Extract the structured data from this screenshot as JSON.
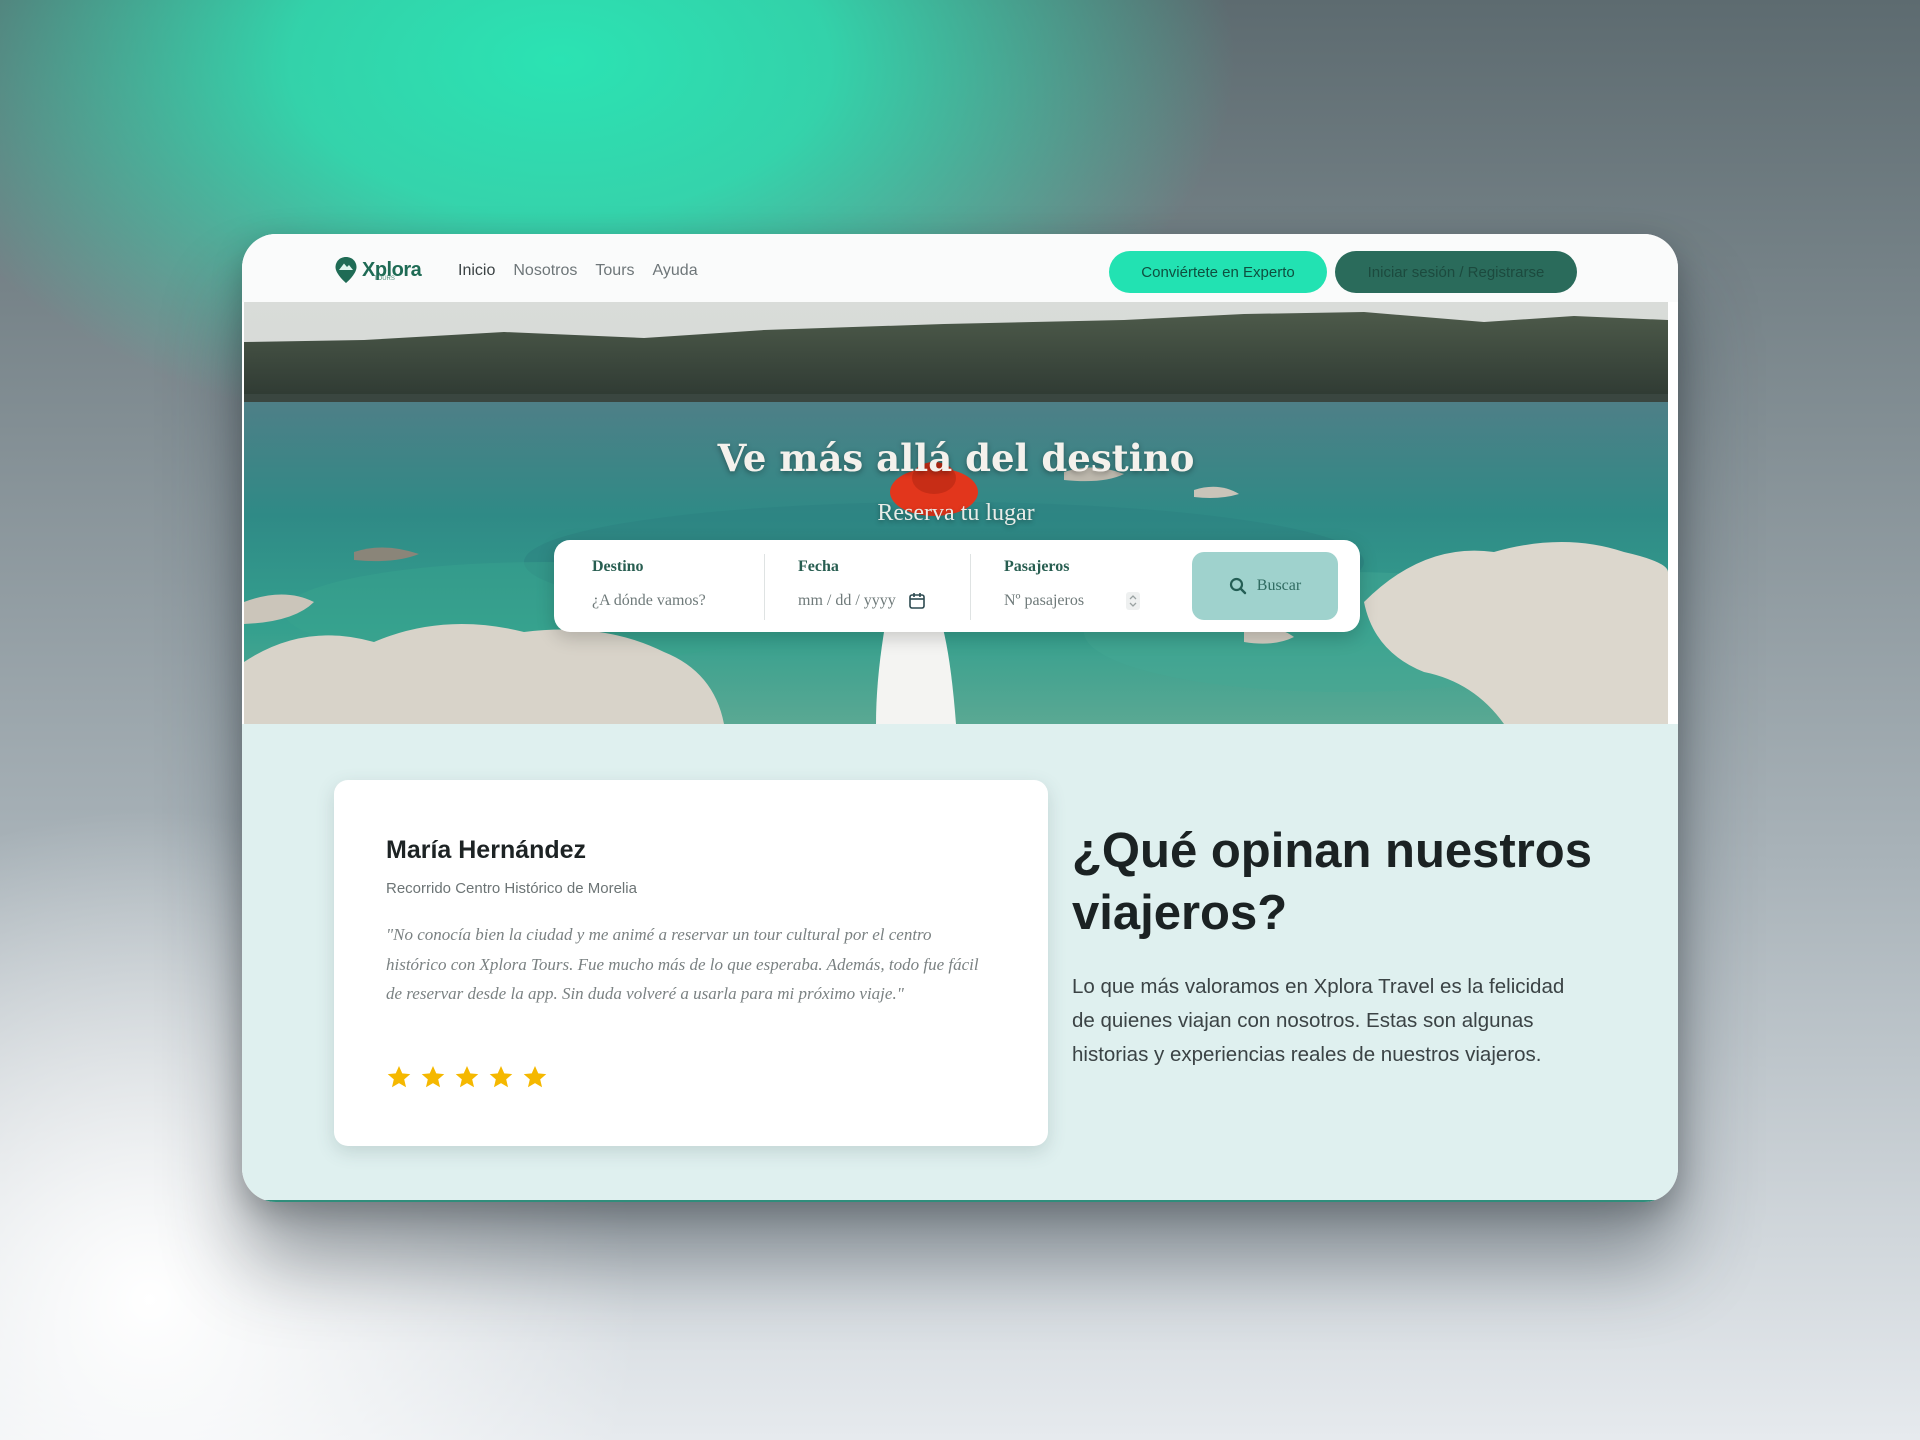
{
  "nav": {
    "logo_text": "Xplora",
    "logo_sub": "TOURS",
    "links": [
      "Inicio",
      "Nosotros",
      "Tours",
      "Ayuda"
    ],
    "expert_button": "Conviértete en Experto",
    "login_button": "Iniciar sesión / Registrarse"
  },
  "hero": {
    "title": "Ve más allá del destino",
    "subtitle": "Reserva tu lugar"
  },
  "search": {
    "destino_label": "Destino",
    "destino_placeholder": "¿A dónde vamos?",
    "fecha_label": "Fecha",
    "fecha_placeholder": "mm / dd / yyyy",
    "pasajeros_label": "Pasajeros",
    "pasajeros_placeholder": "Nº pasajeros",
    "button_label": "Buscar"
  },
  "testimonial": {
    "name": "María Hernández",
    "tour": "Recorrido Centro Histórico de Morelia",
    "quote": "\"No conocía bien la ciudad y me animé a reservar un tour cultural por el centro histórico con Xplora Tours. Fue mucho más de lo que esperaba. Además, todo fue fácil de reservar desde la app. Sin duda volveré a usarla para mi próximo viaje.\"",
    "rating": 5
  },
  "section": {
    "title": "¿Qué opinan nuestros viajeros?",
    "text": "Lo que más valoramos en Xplora Travel es la felicidad de quienes viajan con nosotros. Estas son algunas historias y experiencias reales de nuestros viajeros."
  },
  "colors": {
    "accent": "#22e2b2",
    "dark_green": "#2a6b5b",
    "section_bg": "#dff0ef",
    "star": "#f5b800"
  }
}
